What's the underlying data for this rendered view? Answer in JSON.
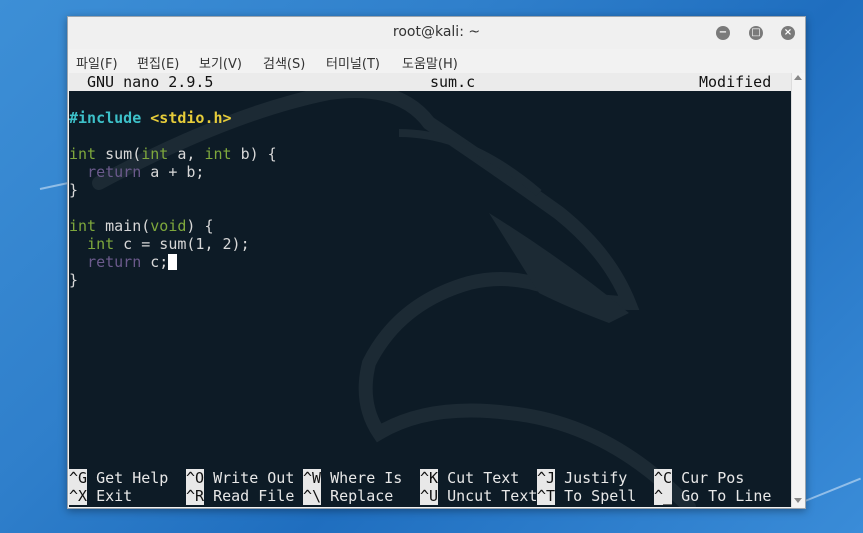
{
  "window": {
    "title": "root@kali: ~",
    "controls": {
      "minimize": "−",
      "maximize": "□",
      "close": "×"
    }
  },
  "menubar": [
    "파일(F)",
    "편집(E)",
    "보기(V)",
    "검색(S)",
    "터미널(T)",
    "도움말(H)"
  ],
  "nano_header": {
    "version": "GNU nano 2.9.5",
    "filename": "sum.c",
    "status": "Modified"
  },
  "code": {
    "include_directive": "#include",
    "include_file": "<stdio.h>",
    "line_sum_sig": {
      "t1": "int",
      "fn": " sum(",
      "t2": "int",
      "p1": " a, ",
      "t3": "int",
      "p2": " b) {"
    },
    "line_return_ab": {
      "kw": "return",
      "rest": " a + b;"
    },
    "close_brace": "}",
    "line_main_sig": {
      "t1": "int",
      "fn": " main(",
      "t2": "void",
      "rest": ") {"
    },
    "line_int_c": {
      "t1": "int",
      "rest": " c = sum(1, 2);"
    },
    "line_return_c": {
      "kw": "return",
      "rest": " c;"
    }
  },
  "shortcuts": [
    [
      {
        "key": "^G",
        "label": "Get Help"
      },
      {
        "key": "^O",
        "label": "Write Out"
      },
      {
        "key": "^W",
        "label": "Where Is"
      },
      {
        "key": "^K",
        "label": "Cut Text"
      },
      {
        "key": "^J",
        "label": "Justify"
      },
      {
        "key": "^C",
        "label": "Cur Pos"
      }
    ],
    [
      {
        "key": "^X",
        "label": "Exit"
      },
      {
        "key": "^R",
        "label": "Read File"
      },
      {
        "key": "^\\",
        "label": "Replace"
      },
      {
        "key": "^U",
        "label": "Uncut Text"
      },
      {
        "key": "^T",
        "label": "To Spell"
      },
      {
        "key": "^_",
        "label": "Go To Line"
      }
    ]
  ]
}
